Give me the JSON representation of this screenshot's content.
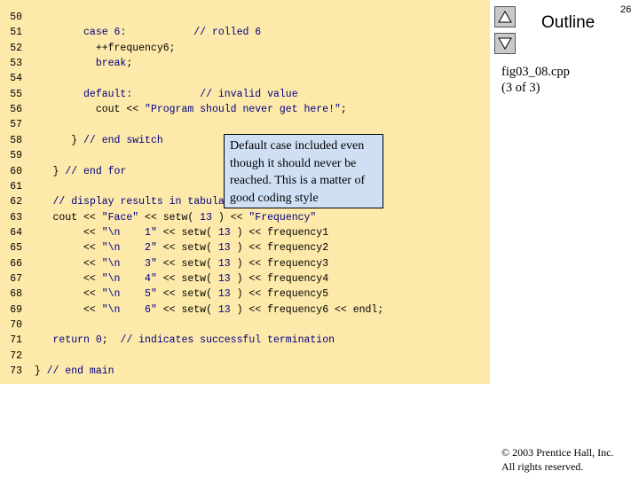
{
  "code": {
    "lines": [
      {
        "num": "50",
        "segments": [
          {
            "t": "",
            "c": ""
          }
        ]
      },
      {
        "num": "51",
        "segments": [
          {
            "t": "        case ",
            "c": "kw"
          },
          {
            "t": "6",
            "c": "kw"
          },
          {
            "t": ":           ",
            "c": "kw"
          },
          {
            "t": "// rolled 6",
            "c": "cm"
          }
        ]
      },
      {
        "num": "52",
        "segments": [
          {
            "t": "          ++frequency6;",
            "c": ""
          }
        ]
      },
      {
        "num": "53",
        "segments": [
          {
            "t": "          break",
            "c": "kw"
          },
          {
            "t": ";",
            "c": ""
          }
        ]
      },
      {
        "num": "54",
        "segments": [
          {
            "t": "",
            "c": ""
          }
        ]
      },
      {
        "num": "55",
        "segments": [
          {
            "t": "        default",
            "c": "kw"
          },
          {
            "t": ":           ",
            "c": "kw"
          },
          {
            "t": "// invalid value",
            "c": "cm"
          }
        ]
      },
      {
        "num": "56",
        "segments": [
          {
            "t": "          cout << ",
            "c": ""
          },
          {
            "t": "\"Program should never get here!\"",
            "c": "str"
          },
          {
            "t": ";",
            "c": ""
          }
        ]
      },
      {
        "num": "57",
        "segments": [
          {
            "t": "",
            "c": ""
          }
        ]
      },
      {
        "num": "58",
        "segments": [
          {
            "t": "      } ",
            "c": ""
          },
          {
            "t": "// end switch",
            "c": "cm"
          }
        ]
      },
      {
        "num": "59",
        "segments": [
          {
            "t": "",
            "c": ""
          }
        ]
      },
      {
        "num": "60",
        "segments": [
          {
            "t": "   } ",
            "c": ""
          },
          {
            "t": "// end for",
            "c": "cm"
          }
        ]
      },
      {
        "num": "61",
        "segments": [
          {
            "t": "",
            "c": ""
          }
        ]
      },
      {
        "num": "62",
        "segments": [
          {
            "t": "   ",
            "c": ""
          },
          {
            "t": "// display results in tabular format",
            "c": "cm"
          }
        ]
      },
      {
        "num": "63",
        "segments": [
          {
            "t": "   cout << ",
            "c": ""
          },
          {
            "t": "\"Face\"",
            "c": "str"
          },
          {
            "t": " << setw( ",
            "c": ""
          },
          {
            "t": "13",
            "c": "kw"
          },
          {
            "t": " ) << ",
            "c": ""
          },
          {
            "t": "\"Frequency\"",
            "c": "str"
          }
        ]
      },
      {
        "num": "64",
        "segments": [
          {
            "t": "        << ",
            "c": ""
          },
          {
            "t": "\"\\n    1\"",
            "c": "str"
          },
          {
            "t": " << setw( ",
            "c": ""
          },
          {
            "t": "13",
            "c": "kw"
          },
          {
            "t": " ) << frequency1",
            "c": ""
          }
        ]
      },
      {
        "num": "65",
        "segments": [
          {
            "t": "        << ",
            "c": ""
          },
          {
            "t": "\"\\n    2\"",
            "c": "str"
          },
          {
            "t": " << setw( ",
            "c": ""
          },
          {
            "t": "13",
            "c": "kw"
          },
          {
            "t": " ) << frequency2",
            "c": ""
          }
        ]
      },
      {
        "num": "66",
        "segments": [
          {
            "t": "        << ",
            "c": ""
          },
          {
            "t": "\"\\n    3\"",
            "c": "str"
          },
          {
            "t": " << setw( ",
            "c": ""
          },
          {
            "t": "13",
            "c": "kw"
          },
          {
            "t": " ) << frequency3",
            "c": ""
          }
        ]
      },
      {
        "num": "67",
        "segments": [
          {
            "t": "        << ",
            "c": ""
          },
          {
            "t": "\"\\n    4\"",
            "c": "str"
          },
          {
            "t": " << setw( ",
            "c": ""
          },
          {
            "t": "13",
            "c": "kw"
          },
          {
            "t": " ) << frequency4",
            "c": ""
          }
        ]
      },
      {
        "num": "68",
        "segments": [
          {
            "t": "        << ",
            "c": ""
          },
          {
            "t": "\"\\n    5\"",
            "c": "str"
          },
          {
            "t": " << setw( ",
            "c": ""
          },
          {
            "t": "13",
            "c": "kw"
          },
          {
            "t": " ) << frequency5",
            "c": ""
          }
        ]
      },
      {
        "num": "69",
        "segments": [
          {
            "t": "        << ",
            "c": ""
          },
          {
            "t": "\"\\n    6\"",
            "c": "str"
          },
          {
            "t": " << setw( ",
            "c": ""
          },
          {
            "t": "13",
            "c": "kw"
          },
          {
            "t": " ) << frequency6 << endl;",
            "c": ""
          }
        ]
      },
      {
        "num": "70",
        "segments": [
          {
            "t": "",
            "c": ""
          }
        ]
      },
      {
        "num": "71",
        "segments": [
          {
            "t": "   return ",
            "c": "kw"
          },
          {
            "t": "0",
            "c": "kw"
          },
          {
            "t": ";  ",
            "c": ""
          },
          {
            "t": "// indicates successful termination",
            "c": "cm"
          }
        ]
      },
      {
        "num": "72",
        "segments": [
          {
            "t": "",
            "c": ""
          }
        ]
      },
      {
        "num": "73",
        "segments": [
          {
            "t": "} ",
            "c": ""
          },
          {
            "t": "// end main",
            "c": "cm"
          }
        ]
      }
    ]
  },
  "callout": {
    "text": "Default case included even though it should never be reached. This is a matter of good coding style"
  },
  "sidebar": {
    "outline_title": "Outline",
    "file_name": "fig03_08.cpp",
    "file_part": "(3 of 3)",
    "prev_icon": "triangle-up-icon",
    "next_icon": "triangle-down-icon"
  },
  "page_number": "26",
  "copyright": {
    "line1": "© 2003 Prentice Hall, Inc.",
    "line2": "All rights reserved."
  },
  "colors": {
    "code_background": "#fde9aa",
    "callout_background": "#cfe0f5",
    "code_highlight": "#000080"
  }
}
